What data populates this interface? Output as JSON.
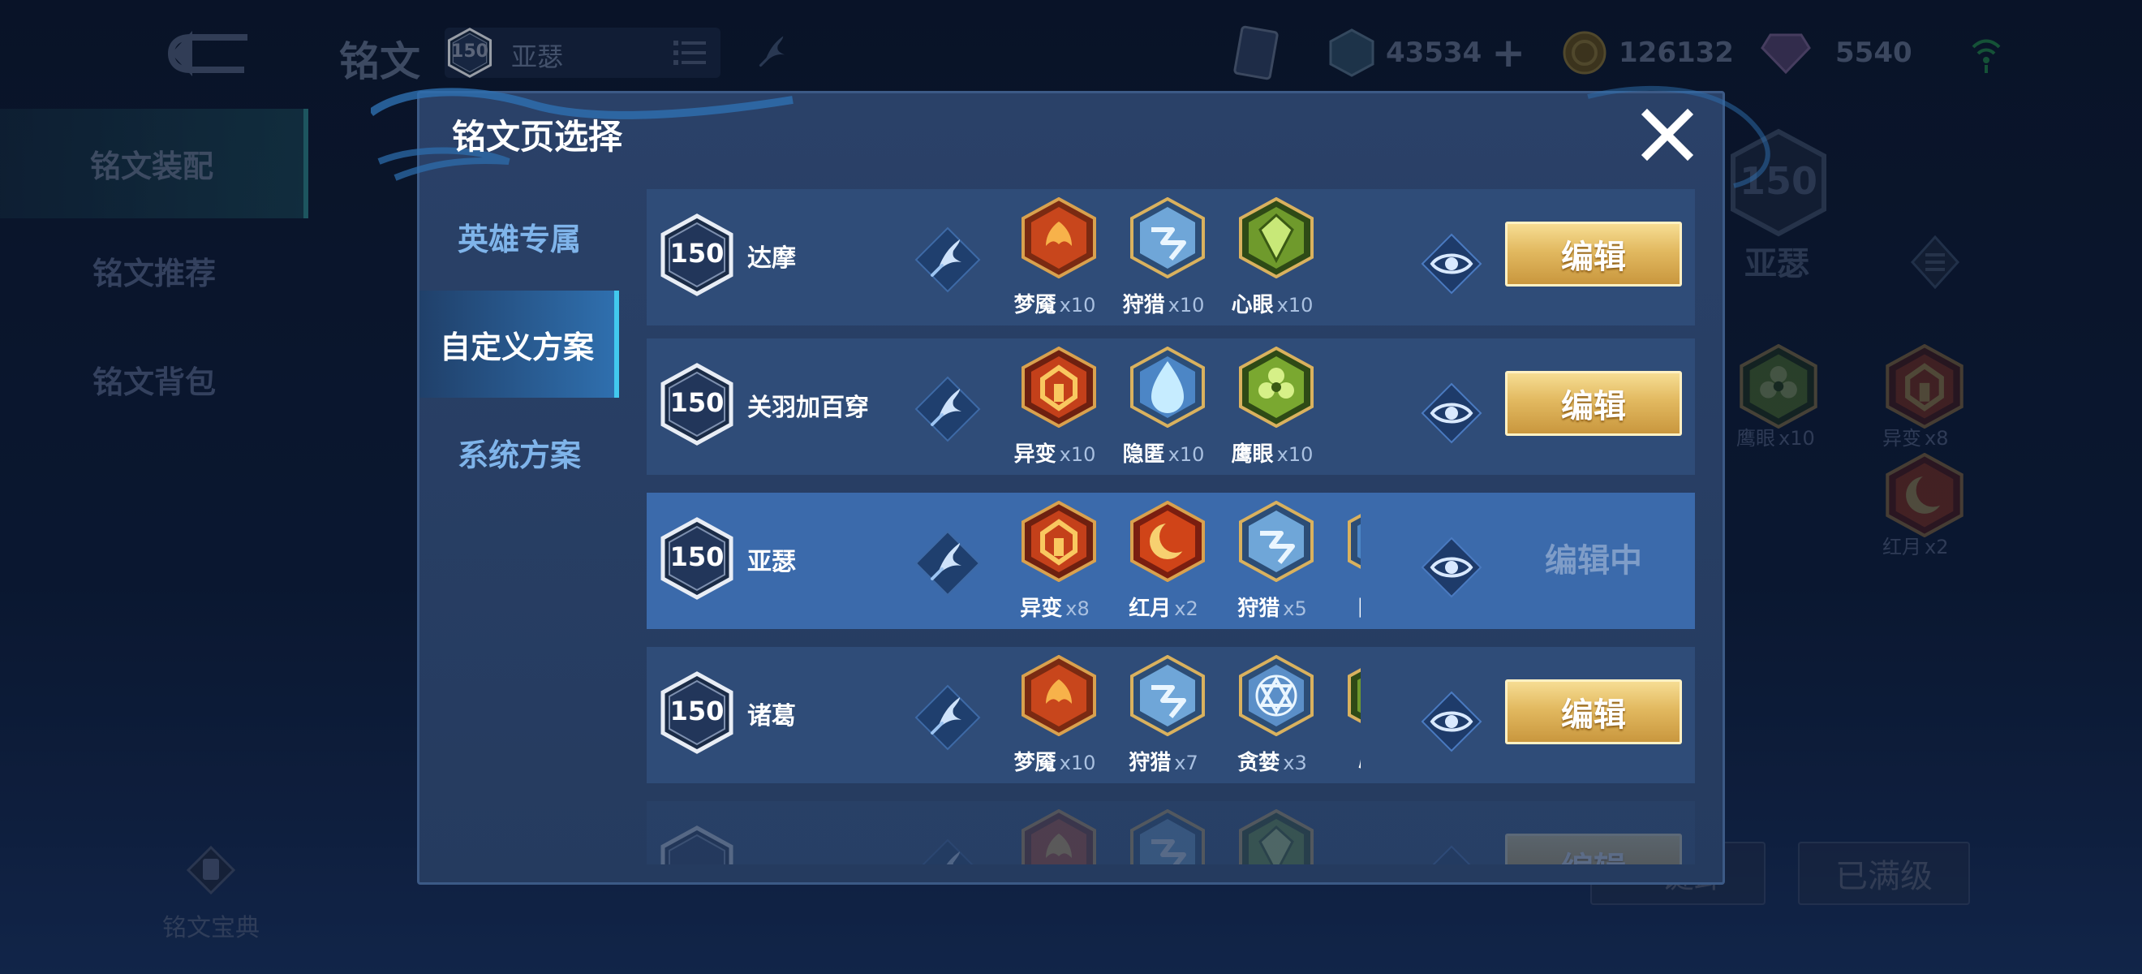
{
  "header": {
    "title": "铭文",
    "hero_select": {
      "level": "150",
      "name": "亚瑟"
    },
    "currencies": [
      {
        "icon": "gem-icon",
        "amount": "43534"
      },
      {
        "icon": "gold-coin-icon",
        "amount": "126132"
      },
      {
        "icon": "diamond-icon",
        "amount": "5540"
      }
    ]
  },
  "left_nav": {
    "items": [
      {
        "label": "铭文装配"
      },
      {
        "label": "铭文推荐"
      },
      {
        "label": "铭文背包"
      }
    ],
    "codex_label": "铭文宝典"
  },
  "right_panel": {
    "level": "150",
    "hero_name": "亚瑟",
    "runes": [
      {
        "name": "鹰眼",
        "count": "x10"
      },
      {
        "name": "异变",
        "count": "x8"
      },
      {
        "name": "红月",
        "count": "x2"
      }
    ],
    "buttons": {
      "unload": "一键卸",
      "maxed": "已满级"
    }
  },
  "dialog": {
    "title": "铭文页选择",
    "tabs": [
      {
        "label": "英雄专属"
      },
      {
        "label": "自定义方案"
      },
      {
        "label": "系统方案"
      }
    ],
    "edit_label": "编辑",
    "editing_label": "编辑中",
    "pages": [
      {
        "level": "150",
        "name": "达摩",
        "runes": [
          {
            "name": "梦魇",
            "count": "x10"
          },
          {
            "name": "狩猎",
            "count": "x10"
          },
          {
            "name": "心眼",
            "count": "x10"
          }
        ]
      },
      {
        "level": "150",
        "name": "关羽加百穿",
        "runes": [
          {
            "name": "异变",
            "count": "x10"
          },
          {
            "name": "隐匿",
            "count": "x10"
          },
          {
            "name": "鹰眼",
            "count": "x10"
          }
        ]
      },
      {
        "level": "150",
        "name": "亚瑟",
        "runes": [
          {
            "name": "异变",
            "count": "x8"
          },
          {
            "name": "红月",
            "count": "x2"
          },
          {
            "name": "狩猎",
            "count": "x5"
          },
          {
            "name": "隐匿",
            "count": ""
          }
        ]
      },
      {
        "level": "150",
        "name": "诸葛",
        "runes": [
          {
            "name": "梦魇",
            "count": "x10"
          },
          {
            "name": "狩猎",
            "count": "x7"
          },
          {
            "name": "贪婪",
            "count": "x3"
          },
          {
            "name": "心眼",
            "count": ""
          }
        ]
      }
    ]
  }
}
